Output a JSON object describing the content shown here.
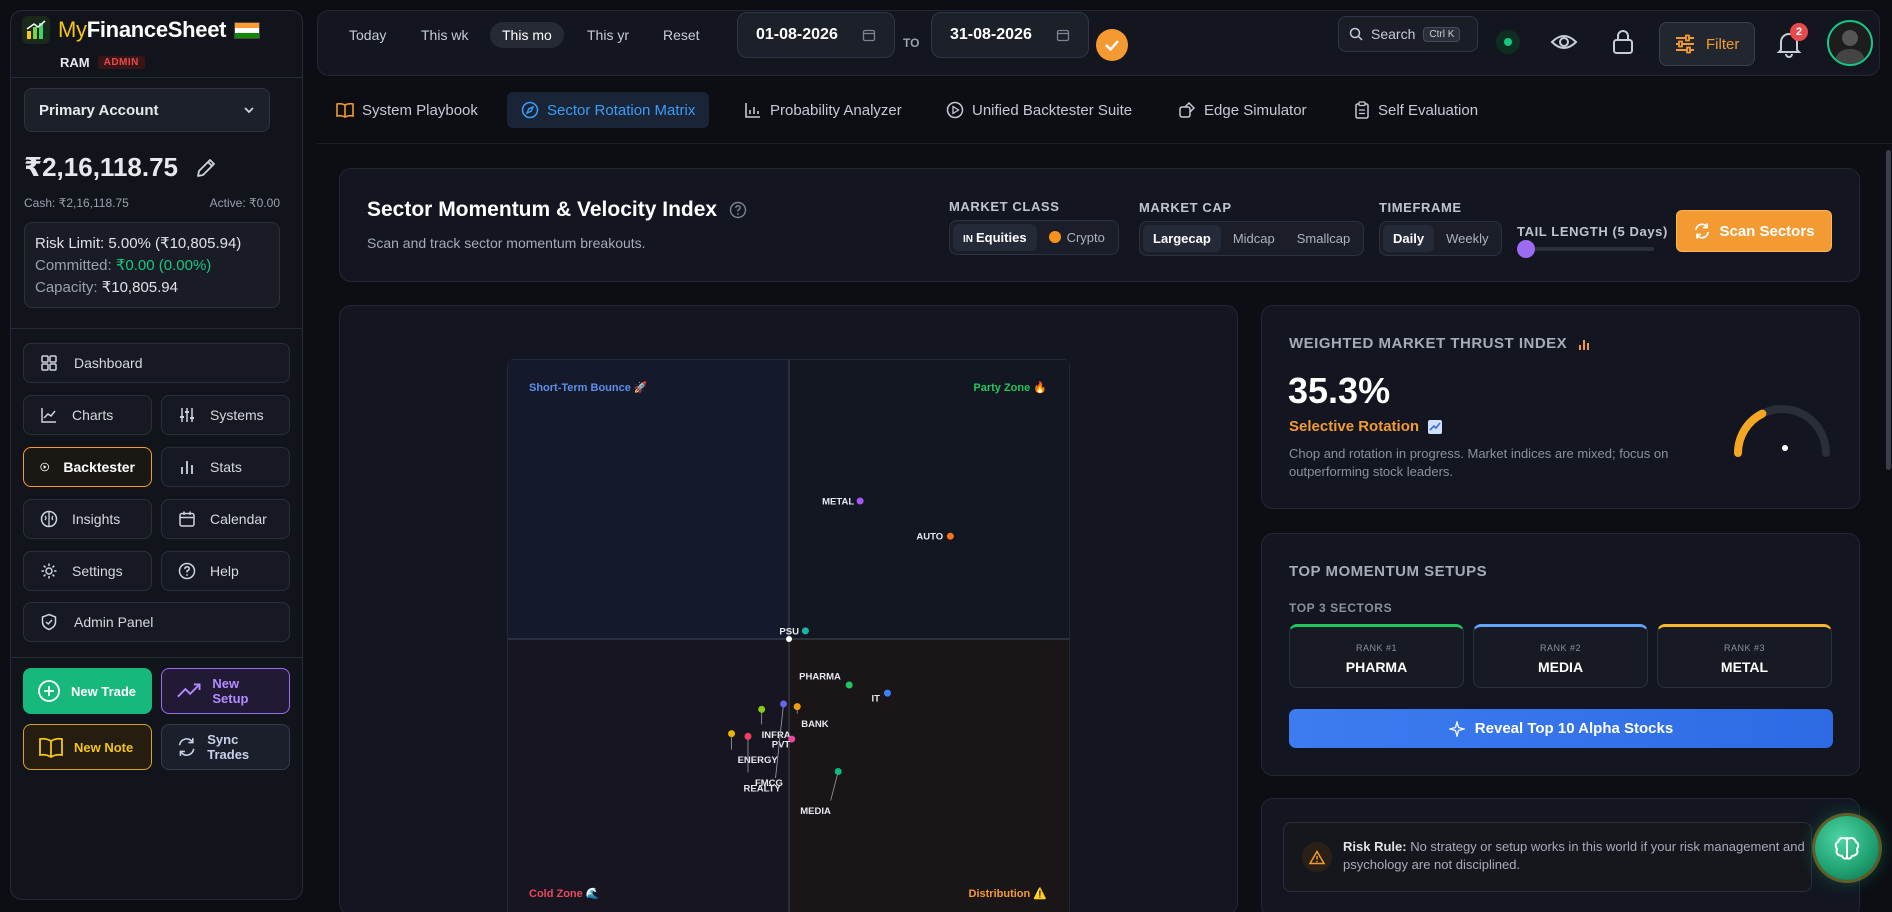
{
  "brand": {
    "name_prefix": "My",
    "name_main": "FinanceSheet",
    "user": "RAM",
    "role": "ADMIN"
  },
  "account": {
    "selected": "Primary Account",
    "balance": "₹2,16,118.75",
    "cash": "Cash: ₹2,16,118.75",
    "active": "Active: ₹0.00",
    "risk_limit": "Risk Limit: 5.00% (₹10,805.94)",
    "committed_label": "Committed:",
    "committed_value": "₹0.00 (0.00%)",
    "capacity_label": "Capacity:",
    "capacity_value": "₹10,805.94"
  },
  "nav": {
    "dashboard": "Dashboard",
    "charts": "Charts",
    "systems": "Systems",
    "backtester": "Backtester",
    "stats": "Stats",
    "insights": "Insights",
    "calendar": "Calendar",
    "settings": "Settings",
    "help": "Help",
    "admin": "Admin Panel"
  },
  "actions": {
    "new_trade": "New Trade",
    "new_setup": "New Setup",
    "new_note": "New Note",
    "sync_trades": "Sync Trades"
  },
  "topbar": {
    "quick": [
      "Today",
      "This wk",
      "This mo",
      "This yr",
      "Reset"
    ],
    "date_from": "01-08-2026",
    "to_label": "TO",
    "date_to": "31-08-2026",
    "search": "Search",
    "search_kbd": "Ctrl K",
    "filter": "Filter",
    "notif_count": "2"
  },
  "tabs": [
    "System Playbook",
    "Sector Rotation Matrix",
    "Probability Analyzer",
    "Unified Backtester Suite",
    "Edge Simulator",
    "Self Evaluation"
  ],
  "header": {
    "title": "Sector Momentum & Velocity Index",
    "subtitle": "Scan and track sector momentum breakouts.",
    "market_class_label": "MARKET CLASS",
    "equities": "Equities",
    "equities_prefix": "IN",
    "crypto": "Crypto",
    "market_cap_label": "MARKET CAP",
    "largecap": "Largecap",
    "midcap": "Midcap",
    "smallcap": "Smallcap",
    "timeframe_label": "TIMEFRAME",
    "daily": "Daily",
    "weekly": "Weekly",
    "tail_label": "TAIL LENGTH (5 Days)",
    "tail_value": 0,
    "scan_button": "Scan Sectors"
  },
  "chart_data": {
    "type": "scatter",
    "title": "",
    "xlabel": "",
    "ylabel": "",
    "quadrants": {
      "top_left": "Short-Term Bounce 🚀",
      "top_right": "Party Zone 🔥",
      "bottom_left": "Cold Zone 🌊",
      "bottom_right": "Distribution ⚠️"
    },
    "xlim": [
      -100,
      100
    ],
    "ylim": [
      -100,
      100
    ],
    "points": [
      {
        "label": "METAL",
        "x": 26,
        "y": 51,
        "color": "#a855f7"
      },
      {
        "label": "AUTO",
        "x": 59,
        "y": 38,
        "color": "#f97316"
      },
      {
        "label": "PSU",
        "x": 6,
        "y": 3,
        "color": "#14b8a6"
      },
      {
        "label": "PHARMA",
        "x": 22,
        "y": -17,
        "color": "#22c55e"
      },
      {
        "label": "IT",
        "x": 36,
        "y": -20,
        "color": "#3b82f6"
      },
      {
        "label": "BANK",
        "x": 3,
        "y": -25,
        "color": "#f59e0b"
      },
      {
        "label": "INFRA",
        "x": -10,
        "y": -26,
        "color": "#84cc16"
      },
      {
        "label": "PVT",
        "x": 1,
        "y": -37,
        "color": "#ec4899"
      },
      {
        "label": "ENERGY",
        "x": -21,
        "y": -35,
        "color": "#eab308"
      },
      {
        "label": "FMCG",
        "x": -15,
        "y": -36,
        "color": "#f43f5e"
      },
      {
        "label": "REALTY",
        "x": -2,
        "y": -24,
        "color": "#6366f1"
      },
      {
        "label": "MEDIA",
        "x": 18,
        "y": -49,
        "color": "#10b981"
      }
    ],
    "label_offsets": {
      "METAL": [
        -38,
        0
      ],
      "AUTO": [
        -34,
        0
      ],
      "PSU": [
        -26,
        0
      ],
      "PHARMA": [
        -50,
        -9
      ],
      "IT": [
        -16,
        5
      ],
      "BANK": [
        4,
        17
      ],
      "INFRA": [
        0,
        25
      ],
      "PVT": [
        -20,
        5
      ],
      "ENERGY": [
        6,
        26
      ],
      "FMCG": [
        7,
        46
      ],
      "REALTY": [
        -40,
        84
      ],
      "MEDIA": [
        -38,
        39
      ]
    }
  },
  "thrust": {
    "title": "WEIGHTED MARKET THRUST INDEX",
    "value": "35.3%",
    "value_pct": 35.3,
    "state": "Selective Rotation",
    "desc": "Chop and rotation in progress. Market indices are mixed; focus on outperforming stock leaders."
  },
  "momentum": {
    "title": "TOP MOMENTUM SETUPS",
    "subtitle": "TOP 3 SECTORS",
    "ranks": [
      {
        "rank": "RANK #1",
        "name": "PHARMA",
        "color": "#22c55e"
      },
      {
        "rank": "RANK #2",
        "name": "MEDIA",
        "color": "#60a5fa"
      },
      {
        "rank": "RANK #3",
        "name": "METAL",
        "color": "#f5b82e"
      }
    ],
    "reveal_button": "Reveal Top 10 Alpha Stocks"
  },
  "risk_rule": {
    "label": "Risk Rule:",
    "text": "No strategy or setup works in this world if your risk management and psychology are not disciplined."
  },
  "colors": {
    "accent_orange": "#f39a33",
    "accent_blue": "#3d9cf5",
    "accent_green": "#16c784",
    "accent_purple": "#9b6cf2"
  }
}
